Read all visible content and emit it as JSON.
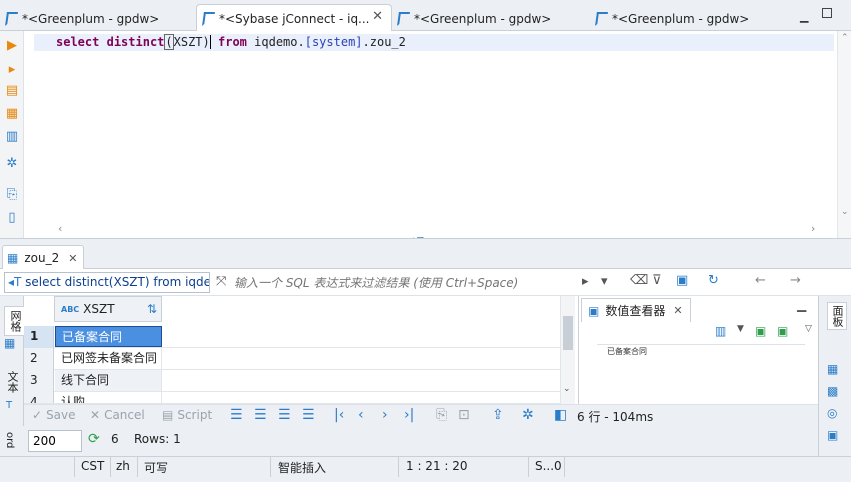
{
  "tabs": [
    {
      "label": "*<Greenplum - gpdw>",
      "active": false,
      "closable": false
    },
    {
      "label": "*<Sybase jConnect - iq...",
      "active": true,
      "closable": true
    },
    {
      "label": "*<Greenplum - gpdw>",
      "active": false,
      "closable": false
    },
    {
      "label": "*<Greenplum - gpdw>",
      "active": false,
      "closable": false
    }
  ],
  "editor": {
    "kw_select": "select",
    "kw_distinct": "distinct",
    "paren_open": "(",
    "column": "XSZT",
    "paren_close": ")",
    "kw_from": "from",
    "schema_prefix": "iqdemo.",
    "schema_bracket": "[system]",
    "table_suffix": ".zou_2"
  },
  "results": {
    "tab_label": "zou_2",
    "query_label": "select distinct(XSZT) from iqden",
    "filter_placeholder": "输入一个 SQL 表达式来过滤结果 (使用 Ctrl+Space)",
    "side_tab_grid": "网格",
    "side_tab_text": "文本",
    "column_header": "XSZT",
    "column_type_badge": "ABC",
    "rows": [
      {
        "num": "1",
        "value": "已备案合同"
      },
      {
        "num": "2",
        "value": "已网签未备案合同"
      },
      {
        "num": "3",
        "value": "线下合同"
      },
      {
        "num": "4",
        "value": "认购"
      }
    ]
  },
  "value_viewer": {
    "title": "数值查看器",
    "content": "已备案合同",
    "side_label": "面板"
  },
  "bottom_toolbar": {
    "save": "Save",
    "cancel": "Cancel",
    "script": "Script",
    "summary": "6 行 - 104ms"
  },
  "fetch": {
    "label": "ord",
    "size": "200",
    "count": "6",
    "rows_label": "Rows: 1"
  },
  "status": {
    "timezone": "CST",
    "locale": "zh",
    "writable": "可写",
    "insert_mode": "智能插入",
    "position": "1 : 21 : 20",
    "selection": "S...0"
  },
  "colors": {
    "accent": "#2b7dc9",
    "keyword": "#7f0055",
    "selection": "#4a8fe0"
  }
}
